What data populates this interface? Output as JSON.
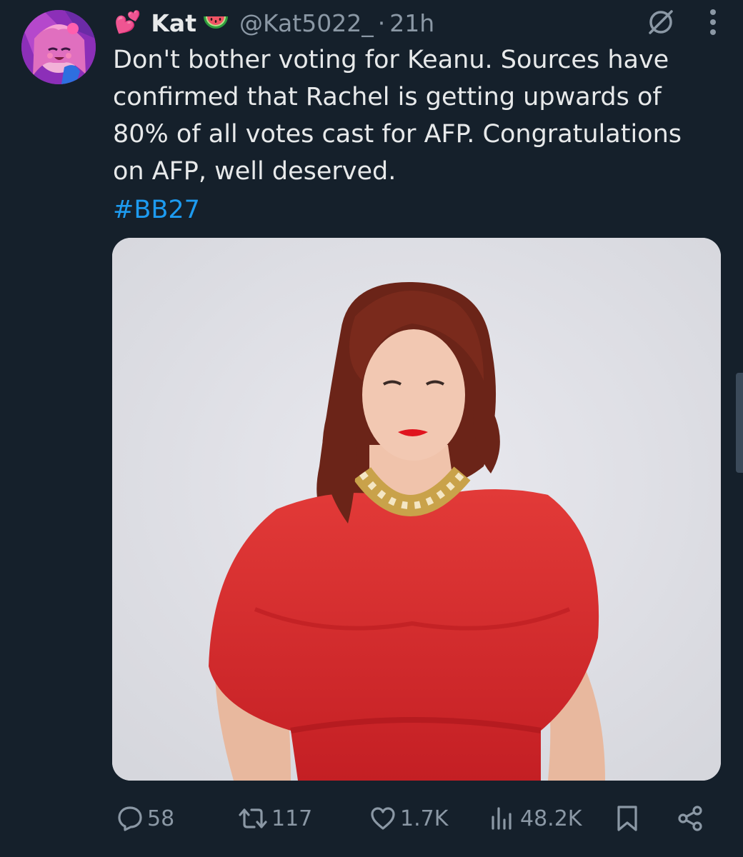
{
  "tweet": {
    "author": {
      "name_prefix_emoji": "💕",
      "display_name": "Kat",
      "name_suffix_emoji": "watermelon",
      "handle": "@Kat5022_",
      "separator": "·",
      "time_ago": "21h"
    },
    "text": "Don't bother voting for Keanu. Sources have confirmed that Rachel is getting upwards of 80% of all votes cast for AFP. Congratulations on AFP, well deserved.",
    "hashtag": "#BB27",
    "media": {
      "icon": "photo"
    },
    "header_icons": [
      "grok-icon",
      "more-icon"
    ]
  },
  "actions": {
    "replies": "58",
    "reposts": "117",
    "likes": "1.7K",
    "views": "48.2K",
    "bookmark_icon": "bookmark-icon",
    "share_icon": "share-icon"
  },
  "colors": {
    "background": "#15202b",
    "text": "#e7e9ea",
    "muted": "#8b98a5",
    "link": "#1d9bf0",
    "dress_red": "#d92b2b"
  }
}
